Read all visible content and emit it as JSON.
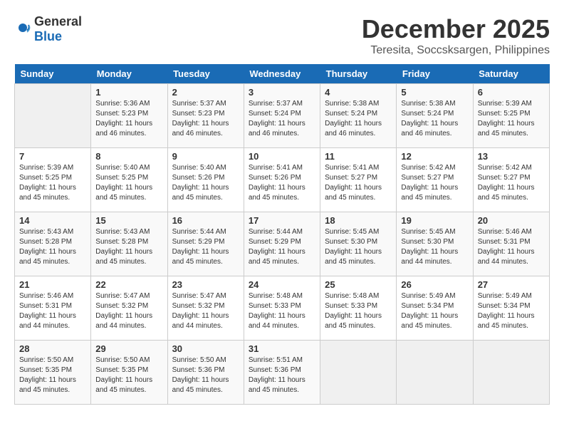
{
  "logo": {
    "general": "General",
    "blue": "Blue"
  },
  "title": "December 2025",
  "subtitle": "Teresita, Soccsksargen, Philippines",
  "days_of_week": [
    "Sunday",
    "Monday",
    "Tuesday",
    "Wednesday",
    "Thursday",
    "Friday",
    "Saturday"
  ],
  "weeks": [
    [
      {
        "day": "",
        "sunrise": "",
        "sunset": "",
        "daylight": ""
      },
      {
        "day": "1",
        "sunrise": "Sunrise: 5:36 AM",
        "sunset": "Sunset: 5:23 PM",
        "daylight": "Daylight: 11 hours and 46 minutes."
      },
      {
        "day": "2",
        "sunrise": "Sunrise: 5:37 AM",
        "sunset": "Sunset: 5:23 PM",
        "daylight": "Daylight: 11 hours and 46 minutes."
      },
      {
        "day": "3",
        "sunrise": "Sunrise: 5:37 AM",
        "sunset": "Sunset: 5:24 PM",
        "daylight": "Daylight: 11 hours and 46 minutes."
      },
      {
        "day": "4",
        "sunrise": "Sunrise: 5:38 AM",
        "sunset": "Sunset: 5:24 PM",
        "daylight": "Daylight: 11 hours and 46 minutes."
      },
      {
        "day": "5",
        "sunrise": "Sunrise: 5:38 AM",
        "sunset": "Sunset: 5:24 PM",
        "daylight": "Daylight: 11 hours and 46 minutes."
      },
      {
        "day": "6",
        "sunrise": "Sunrise: 5:39 AM",
        "sunset": "Sunset: 5:25 PM",
        "daylight": "Daylight: 11 hours and 45 minutes."
      }
    ],
    [
      {
        "day": "7",
        "sunrise": "Sunrise: 5:39 AM",
        "sunset": "Sunset: 5:25 PM",
        "daylight": "Daylight: 11 hours and 45 minutes."
      },
      {
        "day": "8",
        "sunrise": "Sunrise: 5:40 AM",
        "sunset": "Sunset: 5:25 PM",
        "daylight": "Daylight: 11 hours and 45 minutes."
      },
      {
        "day": "9",
        "sunrise": "Sunrise: 5:40 AM",
        "sunset": "Sunset: 5:26 PM",
        "daylight": "Daylight: 11 hours and 45 minutes."
      },
      {
        "day": "10",
        "sunrise": "Sunrise: 5:41 AM",
        "sunset": "Sunset: 5:26 PM",
        "daylight": "Daylight: 11 hours and 45 minutes."
      },
      {
        "day": "11",
        "sunrise": "Sunrise: 5:41 AM",
        "sunset": "Sunset: 5:27 PM",
        "daylight": "Daylight: 11 hours and 45 minutes."
      },
      {
        "day": "12",
        "sunrise": "Sunrise: 5:42 AM",
        "sunset": "Sunset: 5:27 PM",
        "daylight": "Daylight: 11 hours and 45 minutes."
      },
      {
        "day": "13",
        "sunrise": "Sunrise: 5:42 AM",
        "sunset": "Sunset: 5:27 PM",
        "daylight": "Daylight: 11 hours and 45 minutes."
      }
    ],
    [
      {
        "day": "14",
        "sunrise": "Sunrise: 5:43 AM",
        "sunset": "Sunset: 5:28 PM",
        "daylight": "Daylight: 11 hours and 45 minutes."
      },
      {
        "day": "15",
        "sunrise": "Sunrise: 5:43 AM",
        "sunset": "Sunset: 5:28 PM",
        "daylight": "Daylight: 11 hours and 45 minutes."
      },
      {
        "day": "16",
        "sunrise": "Sunrise: 5:44 AM",
        "sunset": "Sunset: 5:29 PM",
        "daylight": "Daylight: 11 hours and 45 minutes."
      },
      {
        "day": "17",
        "sunrise": "Sunrise: 5:44 AM",
        "sunset": "Sunset: 5:29 PM",
        "daylight": "Daylight: 11 hours and 45 minutes."
      },
      {
        "day": "18",
        "sunrise": "Sunrise: 5:45 AM",
        "sunset": "Sunset: 5:30 PM",
        "daylight": "Daylight: 11 hours and 45 minutes."
      },
      {
        "day": "19",
        "sunrise": "Sunrise: 5:45 AM",
        "sunset": "Sunset: 5:30 PM",
        "daylight": "Daylight: 11 hours and 44 minutes."
      },
      {
        "day": "20",
        "sunrise": "Sunrise: 5:46 AM",
        "sunset": "Sunset: 5:31 PM",
        "daylight": "Daylight: 11 hours and 44 minutes."
      }
    ],
    [
      {
        "day": "21",
        "sunrise": "Sunrise: 5:46 AM",
        "sunset": "Sunset: 5:31 PM",
        "daylight": "Daylight: 11 hours and 44 minutes."
      },
      {
        "day": "22",
        "sunrise": "Sunrise: 5:47 AM",
        "sunset": "Sunset: 5:32 PM",
        "daylight": "Daylight: 11 hours and 44 minutes."
      },
      {
        "day": "23",
        "sunrise": "Sunrise: 5:47 AM",
        "sunset": "Sunset: 5:32 PM",
        "daylight": "Daylight: 11 hours and 44 minutes."
      },
      {
        "day": "24",
        "sunrise": "Sunrise: 5:48 AM",
        "sunset": "Sunset: 5:33 PM",
        "daylight": "Daylight: 11 hours and 44 minutes."
      },
      {
        "day": "25",
        "sunrise": "Sunrise: 5:48 AM",
        "sunset": "Sunset: 5:33 PM",
        "daylight": "Daylight: 11 hours and 45 minutes."
      },
      {
        "day": "26",
        "sunrise": "Sunrise: 5:49 AM",
        "sunset": "Sunset: 5:34 PM",
        "daylight": "Daylight: 11 hours and 45 minutes."
      },
      {
        "day": "27",
        "sunrise": "Sunrise: 5:49 AM",
        "sunset": "Sunset: 5:34 PM",
        "daylight": "Daylight: 11 hours and 45 minutes."
      }
    ],
    [
      {
        "day": "28",
        "sunrise": "Sunrise: 5:50 AM",
        "sunset": "Sunset: 5:35 PM",
        "daylight": "Daylight: 11 hours and 45 minutes."
      },
      {
        "day": "29",
        "sunrise": "Sunrise: 5:50 AM",
        "sunset": "Sunset: 5:35 PM",
        "daylight": "Daylight: 11 hours and 45 minutes."
      },
      {
        "day": "30",
        "sunrise": "Sunrise: 5:50 AM",
        "sunset": "Sunset: 5:36 PM",
        "daylight": "Daylight: 11 hours and 45 minutes."
      },
      {
        "day": "31",
        "sunrise": "Sunrise: 5:51 AM",
        "sunset": "Sunset: 5:36 PM",
        "daylight": "Daylight: 11 hours and 45 minutes."
      },
      {
        "day": "",
        "sunrise": "",
        "sunset": "",
        "daylight": ""
      },
      {
        "day": "",
        "sunrise": "",
        "sunset": "",
        "daylight": ""
      },
      {
        "day": "",
        "sunrise": "",
        "sunset": "",
        "daylight": ""
      }
    ]
  ]
}
